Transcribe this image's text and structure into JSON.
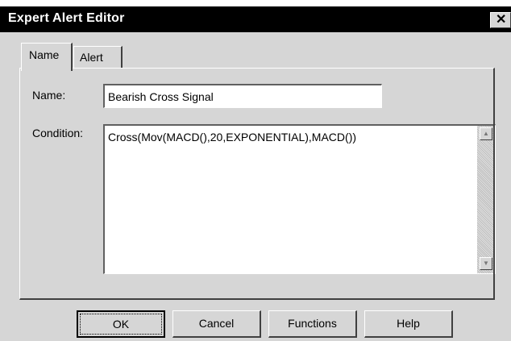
{
  "window": {
    "title": "Expert Alert Editor",
    "close_glyph": "✕"
  },
  "tabs": [
    {
      "label": "Name",
      "active": true
    },
    {
      "label": "Alert",
      "active": false
    }
  ],
  "form": {
    "name_label": "Name:",
    "name_value": "Bearish Cross Signal",
    "condition_label": "Condition:",
    "condition_value": "Cross(Mov(MACD(),20,EXPONENTIAL),MACD())"
  },
  "buttons": {
    "ok": "OK",
    "cancel": "Cancel",
    "functions": "Functions",
    "help": "Help"
  },
  "icons": {
    "close": "close-icon",
    "scroll_up": "scroll-up-arrow-icon",
    "scroll_down": "scroll-down-arrow-icon"
  }
}
